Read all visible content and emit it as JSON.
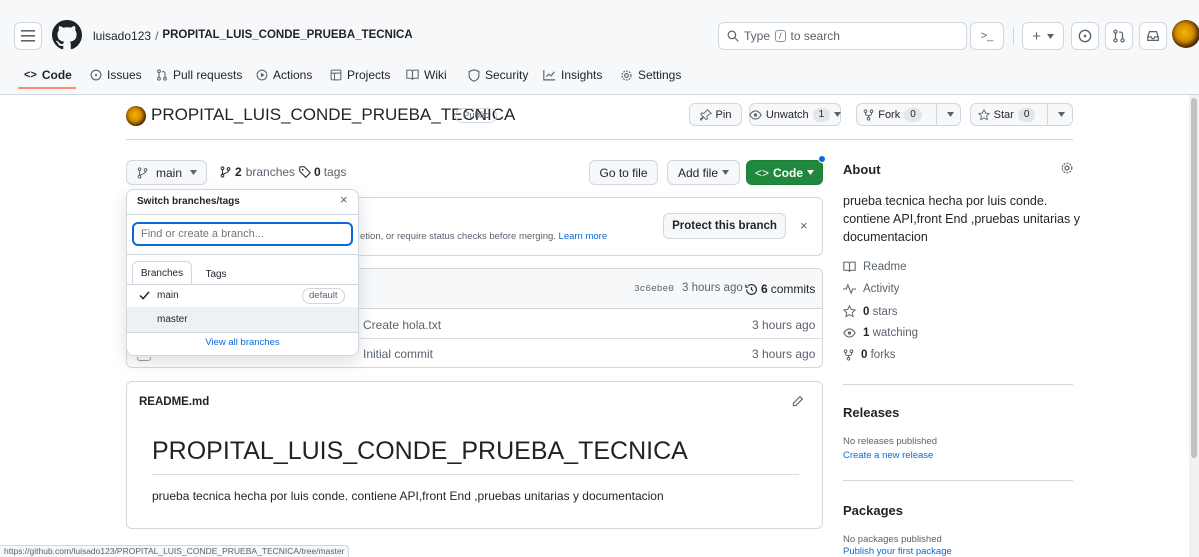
{
  "header": {
    "owner": "luisado123",
    "separator": "/",
    "repo": "PROPITAL_LUIS_CONDE_PRUEBA_TECNICA",
    "search_placeholder": "Type / to search",
    "search_prefix": "Type",
    "search_key": "/",
    "search_suffix": "to search",
    "terminal_label": ">_"
  },
  "tabs": [
    {
      "label": "Code",
      "icon": "code-icon"
    },
    {
      "label": "Issues",
      "icon": "issue-icon"
    },
    {
      "label": "Pull requests",
      "icon": "pull-request-icon"
    },
    {
      "label": "Actions",
      "icon": "play-icon"
    },
    {
      "label": "Projects",
      "icon": "table-icon"
    },
    {
      "label": "Wiki",
      "icon": "book-icon"
    },
    {
      "label": "Security",
      "icon": "shield-icon"
    },
    {
      "label": "Insights",
      "icon": "graph-icon"
    },
    {
      "label": "Settings",
      "icon": "gear-icon"
    }
  ],
  "repo": {
    "title": "PROPITAL_LUIS_CONDE_PRUEBA_TECNICA",
    "visibility": "Public",
    "pin_label": "Pin",
    "unwatch_label": "Unwatch",
    "unwatch_count": "1",
    "fork_label": "Fork",
    "fork_count": "0",
    "star_label": "Star",
    "star_count": "0"
  },
  "toolbar": {
    "branch": "main",
    "branches_count": "2",
    "branches_label": "branches",
    "tags_count": "0",
    "tags_label": "tags",
    "go_to_file": "Go to file",
    "add_file": "Add file",
    "code": "Code"
  },
  "protect": {
    "text": "etion, or require status checks before merging.",
    "learn_more": "Learn more",
    "button": "Protect this branch"
  },
  "commit_bar": {
    "sha": "3c6ebe0",
    "time": "3 hours ago",
    "commits_count": "6",
    "commits_label": "commits"
  },
  "files": [
    {
      "message": "Create hola.txt",
      "time": "3 hours ago"
    },
    {
      "message": "Initial commit",
      "time": "3 hours ago"
    }
  ],
  "dropdown": {
    "title": "Switch branches/tags",
    "placeholder": "Find or create a branch...",
    "tab_branches": "Branches",
    "tab_tags": "Tags",
    "items": [
      {
        "name": "main",
        "badge": "default"
      },
      {
        "name": "master",
        "badge": ""
      }
    ],
    "view_all": "View all branches"
  },
  "readme": {
    "file": "README.md",
    "heading": "PROPITAL_LUIS_CONDE_PRUEBA_TECNICA",
    "body": "prueba tecnica hecha por luis conde. contiene API,front End ,pruebas unitarias y documentacion"
  },
  "about": {
    "title": "About",
    "description": "prueba tecnica hecha por luis conde. contiene API,front End ,pruebas unitarias y documentacion",
    "readme": "Readme",
    "activity": "Activity",
    "stars_count": "0",
    "stars_label": "stars",
    "watching_count": "1",
    "watching_label": "watching",
    "forks_count": "0",
    "forks_label": "forks"
  },
  "releases": {
    "title": "Releases",
    "none": "No releases published",
    "create": "Create a new release"
  },
  "packages": {
    "title": "Packages",
    "none": "No packages published",
    "publish": "Publish your first package"
  },
  "status_bar": {
    "url": "https://github.com/luisado123/PROPITAL_LUIS_CONDE_PRUEBA_TECNICA/tree/master"
  },
  "colors": {
    "accent": "#0969da",
    "green": "#1f883d",
    "tab_underline": "#fd8c73",
    "border": "#d0d7de"
  }
}
